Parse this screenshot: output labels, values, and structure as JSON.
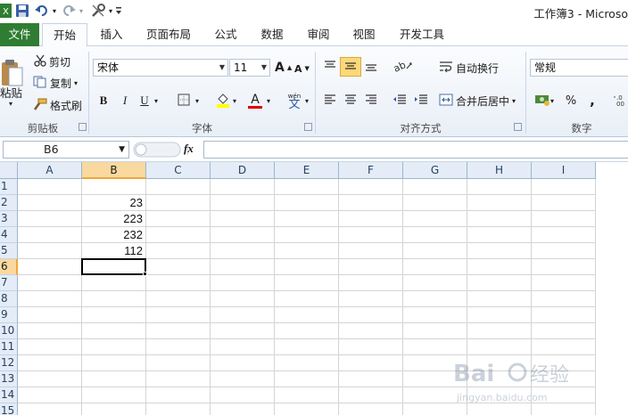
{
  "window": {
    "title": "工作簿3 - Microso"
  },
  "quick_access": {
    "icons": [
      "excel-icon",
      "save-icon",
      "undo-icon",
      "redo-icon",
      "tools-icon",
      "customize-icon"
    ]
  },
  "tabs": [
    {
      "label": "文件",
      "id": "file"
    },
    {
      "label": "开始",
      "id": "home",
      "active": true
    },
    {
      "label": "插入",
      "id": "insert"
    },
    {
      "label": "页面布局",
      "id": "page-layout"
    },
    {
      "label": "公式",
      "id": "formulas"
    },
    {
      "label": "数据",
      "id": "data"
    },
    {
      "label": "审阅",
      "id": "review"
    },
    {
      "label": "视图",
      "id": "view"
    },
    {
      "label": "开发工具",
      "id": "developer"
    }
  ],
  "ribbon": {
    "clipboard": {
      "group_label": "剪贴板",
      "paste_label": "粘贴",
      "cut_label": "剪切",
      "copy_label": "复制",
      "format_painter_label": "格式刷"
    },
    "font": {
      "group_label": "字体",
      "font_name": "宋体",
      "font_size": "11",
      "bold": "B",
      "italic": "I",
      "underline": "U",
      "grow": "A",
      "shrink": "A",
      "font_color_letter": "A",
      "phonetic": "wén",
      "phonetic_char": "文",
      "highlight_color": "#ffff00",
      "font_color": "#e00000"
    },
    "alignment": {
      "group_label": "对齐方式",
      "wrap_text_label": "自动换行",
      "merge_center_label": "合并后居中"
    },
    "number": {
      "group_label": "数字",
      "format": "常规",
      "percent": "%",
      "comma": ","
    }
  },
  "formula_bar": {
    "name_box": "B6",
    "fx": "fx",
    "formula": ""
  },
  "sheet": {
    "columns": [
      "A",
      "B",
      "C",
      "D",
      "E",
      "F",
      "G",
      "H",
      "I"
    ],
    "rows": [
      "1",
      "2",
      "3",
      "4",
      "5",
      "6",
      "7",
      "8",
      "9",
      "10",
      "11",
      "12",
      "13",
      "14",
      "15"
    ],
    "selected_column": "B",
    "selected_row": "6",
    "cells": {
      "B2": "23",
      "B3": "223",
      "B4": "232",
      "B5": "112"
    }
  },
  "colors": {
    "file_tab": "#2f7d32",
    "selection_header": "#f9d99f",
    "selection_accent": "#f2a73a"
  }
}
